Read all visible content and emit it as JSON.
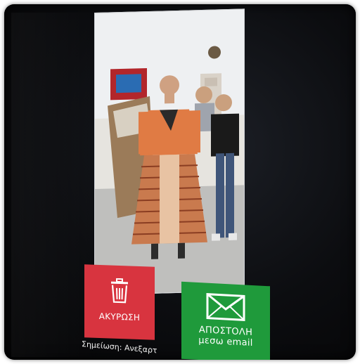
{
  "buttons": {
    "cancel": {
      "label": "ΑΚΥΡΩΣΗ",
      "icon": "trash-icon",
      "color": "#d8343f"
    },
    "send": {
      "label_line1": "ΑΠΟΣΤΟΛΗ",
      "label_line2": "μεσω email",
      "icon": "envelope-icon",
      "color": "#1f9a3b"
    }
  },
  "note": {
    "text": "Σημείωση: Ανεξαρτ"
  },
  "preview": {
    "description_icon": "camera-preview"
  }
}
